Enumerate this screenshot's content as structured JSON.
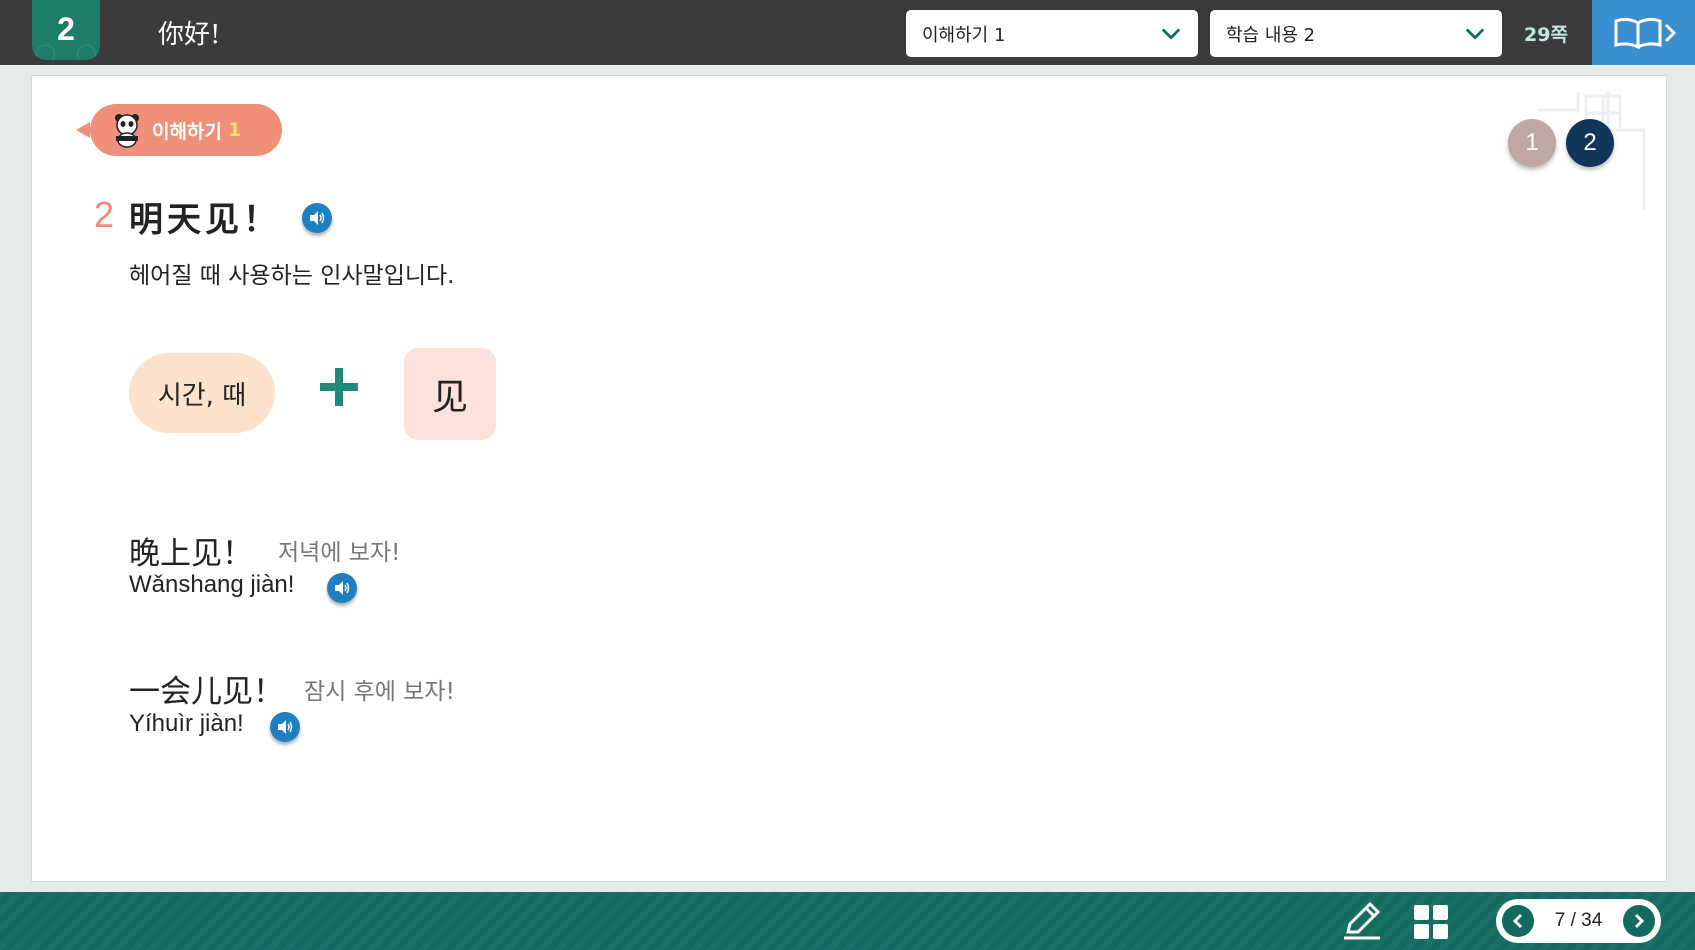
{
  "header": {
    "unit_number": "2",
    "lesson_title": "你好!",
    "dropdown_section": "이해하기 1",
    "dropdown_content": "학습 내용 2",
    "page_ref": "29쪽"
  },
  "section": {
    "tag_label": "이해하기",
    "tag_number": "1",
    "pager": [
      "1",
      "2"
    ],
    "active_page": "2"
  },
  "item": {
    "number": "2",
    "title": "明天见！",
    "description": "헤어질 때 사용하는 인사말입니다."
  },
  "formula": {
    "meaning": "시간, 때",
    "character": "见"
  },
  "examples": [
    {
      "hanzi": "晚上见！",
      "korean": "저녁에 보자!",
      "pinyin": "Wǎnshang jiàn!"
    },
    {
      "hanzi": "一会儿见！",
      "korean": "잠시 후에 보자!",
      "pinyin": "Yíhuìr jiàn!"
    }
  ],
  "footer": {
    "page_indicator": "7 / 34"
  },
  "colors": {
    "accent_teal": "#126a60",
    "tag_coral": "#f0907a",
    "speaker_blue": "#1f7fc2",
    "active_dot": "#12355a"
  }
}
